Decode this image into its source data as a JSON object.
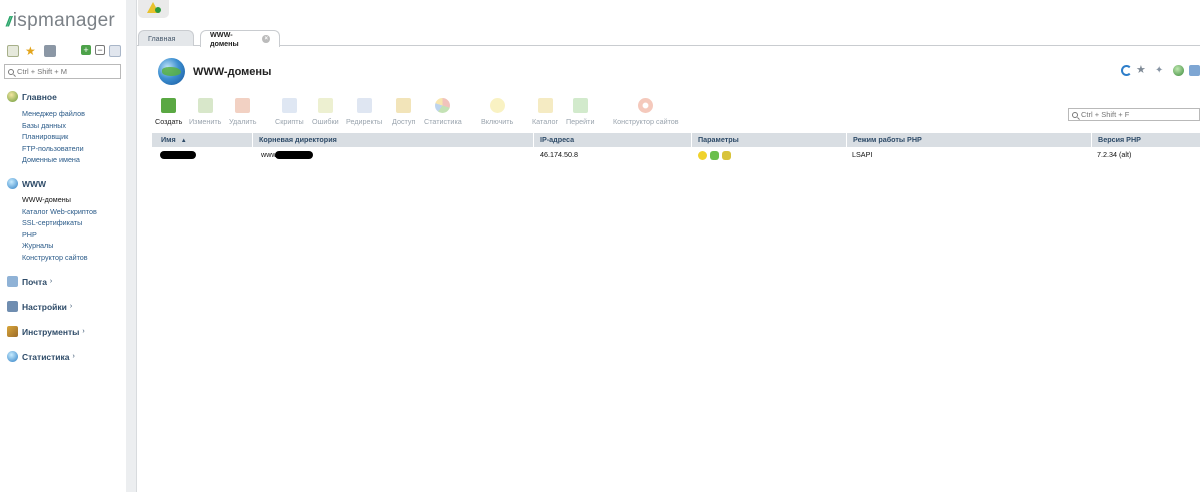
{
  "app": {
    "logo_mark": "//",
    "logo_text": "ispmanager",
    "sidebar_search_placeholder": "Ctrl + Shift + M"
  },
  "sidebar": {
    "sections": [
      {
        "title": "Главное",
        "icon": "home-icon",
        "items": [
          "Менеджер файлов",
          "Базы данных",
          "Планировщик",
          "FTP-пользователи",
          "Доменные имена"
        ]
      },
      {
        "title": "WWW",
        "icon": "www-globe-icon",
        "items": [
          "WWW-домены",
          "Каталог Web-скриптов",
          "SSL-сертификаты",
          "PHP",
          "Журналы",
          "Конструктор сайтов"
        ]
      },
      {
        "title": "Почта",
        "icon": "mail-icon",
        "chevron": "›"
      },
      {
        "title": "Настройки",
        "icon": "settings-icon",
        "chevron": "›"
      },
      {
        "title": "Инструменты",
        "icon": "tools-icon",
        "chevron": "›"
      },
      {
        "title": "Статистика",
        "icon": "statistics-icon",
        "chevron": "›"
      }
    ]
  },
  "tabs": [
    {
      "label": "Главная"
    },
    {
      "label": "WWW-домены",
      "close": "×"
    }
  ],
  "page": {
    "title": "WWW-домены",
    "search_placeholder": "Ctrl + Shift + F"
  },
  "toolbar": [
    {
      "label": "Создать",
      "icon": "create-icon",
      "enabled": true,
      "color": "#5aa843"
    },
    {
      "label": "Изменить",
      "icon": "edit-icon",
      "enabled": false,
      "color": "#a9c98a"
    },
    {
      "label": "Удалить",
      "icon": "delete-icon",
      "enabled": false,
      "color": "#e39a7a"
    },
    {
      "label": "Скрипты",
      "icon": "scripts-icon",
      "enabled": false,
      "color": "#b7c9e4"
    },
    {
      "label": "Ошибки",
      "icon": "errors-icon",
      "enabled": false,
      "color": "#d7de9a"
    },
    {
      "label": "Редиректы",
      "icon": "redirects-icon",
      "enabled": false,
      "color": "#b9c7e2"
    },
    {
      "label": "Доступ",
      "icon": "access-lock-icon",
      "enabled": false,
      "color": "#e2c363"
    },
    {
      "label": "Статистика",
      "icon": "statistics-pie-icon",
      "enabled": false,
      "color": "#e8a0a0"
    },
    {
      "label": "Включить",
      "icon": "enable-bulb-icon",
      "enabled": false,
      "color": "#f2e37a"
    },
    {
      "label": "Каталог",
      "icon": "folder-icon",
      "enabled": false,
      "color": "#e9d27a"
    },
    {
      "label": "Перейти",
      "icon": "goto-icon",
      "enabled": false,
      "color": "#9cd18f"
    },
    {
      "label": "Конструктор сайтов",
      "icon": "site-builder-icon",
      "enabled": false,
      "color": "#e8876a"
    }
  ],
  "table": {
    "columns": [
      "Имя",
      "Корневая директория",
      "IP-адреса",
      "Параметры",
      "Режим работы PHP",
      "Версия PHP"
    ],
    "sort_indicator": "▲",
    "rows": [
      {
        "name": "",
        "root_prefix": "www",
        "ip": "46.174.50.8",
        "php_mode": "LSAPI",
        "php_version": "7.2.34 (alt)",
        "params": [
          {
            "icon": "bulb-active-icon",
            "color": "#f0d22c"
          },
          {
            "icon": "ssi-badge-icon",
            "color": "#6bbf4c"
          },
          {
            "icon": "cgi-badge-icon",
            "color": "#d8c33a"
          }
        ]
      }
    ]
  }
}
